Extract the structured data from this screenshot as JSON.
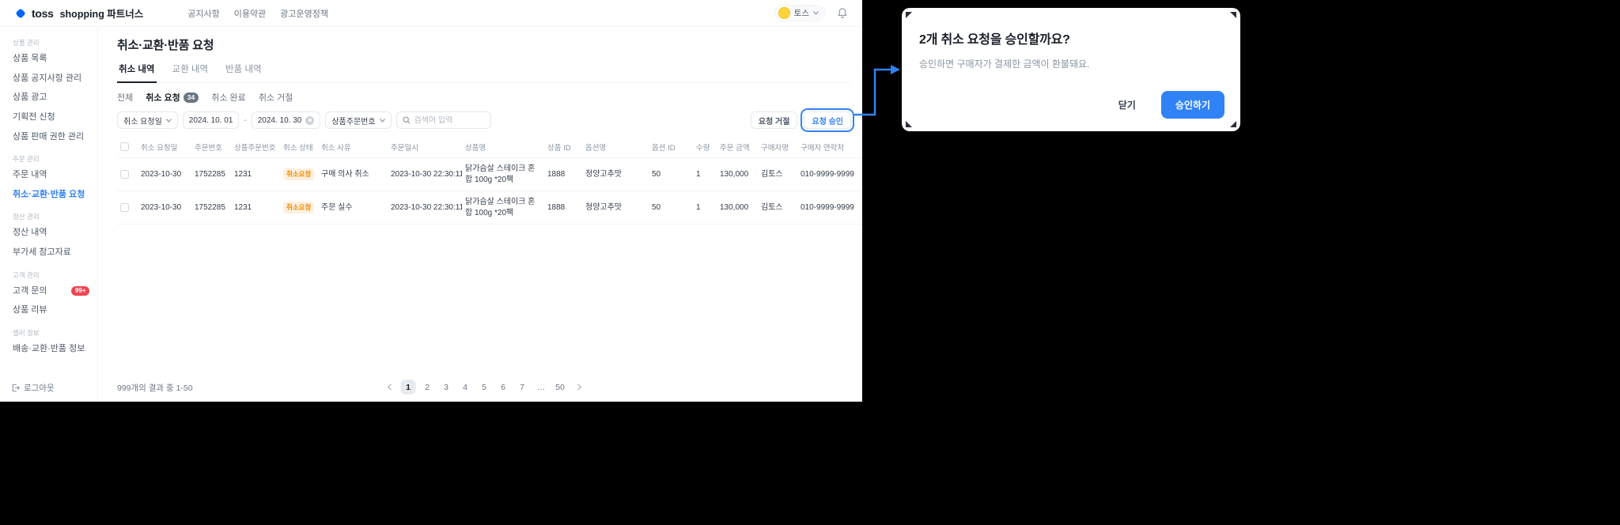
{
  "colors": {
    "accent": "#3182f6",
    "logo_blue": "#0064ff",
    "danger": "#f04452",
    "warning": "#f08c00"
  },
  "navbar": {
    "logo": "toss",
    "brand": "shopping 파트너스",
    "menu": [
      "공지사항",
      "이용약관",
      "광고운영정책"
    ],
    "user": "토스"
  },
  "sidebar": {
    "sections": [
      {
        "label": "상품 관리",
        "items": [
          "상품 목록",
          "상품 공지사항 관리",
          "상품 광고",
          "기획전 신청",
          "상품 판매 권한 관리"
        ]
      },
      {
        "label": "주문 관리",
        "items": [
          "주문 내역",
          "취소·교환·반품 요청"
        ]
      },
      {
        "label": "정산 관리",
        "items": [
          "정산 내역",
          "부가세 참고자료"
        ]
      },
      {
        "label": "고객 관리",
        "items": [
          "고객 문의",
          "상품 리뷰"
        ]
      },
      {
        "label": "셀러 정보",
        "items": [
          "배송·교환·반품 정보"
        ]
      }
    ],
    "inquiry_badge": "99+",
    "logout": "로그아웃"
  },
  "page": {
    "title": "취소·교환·반품 요청",
    "tabs": [
      "취소 내역",
      "교환 내역",
      "반품 내역"
    ],
    "chips": [
      "전체",
      "취소 요청",
      "취소 완료",
      "취소 거절"
    ],
    "chip_count": "34",
    "filters": {
      "date_type": "취소 요청일",
      "date_from": "2024. 10. 01",
      "date_to": "2024. 10. 30",
      "range_separator": "-",
      "search_type": "상품주문번호",
      "search_placeholder": "검색어 입력"
    },
    "actions": {
      "reject": "요청 거절",
      "approve": "요청 승인"
    }
  },
  "table": {
    "headers": [
      "취소 요청일",
      "주문번호",
      "상품주문번호",
      "취소 상태",
      "취소 사유",
      "주문일시",
      "상품명",
      "상품 ID",
      "옵션명",
      "옵션 ID",
      "수량",
      "주문 금액",
      "구매자명",
      "구매자 연락처"
    ],
    "rows": [
      {
        "request_date": "2023-10-30",
        "order_no": "1752285",
        "product_order_no": "1231",
        "status": "취소요청",
        "reason": "구매 의사 취소",
        "order_datetime": "2023-10-30 22:30:11",
        "product_name": "닭가슴살 스테이크 혼합 100g *20팩",
        "product_id": "1888",
        "option_name": "청양고추맛",
        "option_id": "50",
        "qty": "1",
        "amount": "130,000",
        "buyer_name": "김토스",
        "buyer_contact": "010-9999-9999"
      },
      {
        "request_date": "2023-10-30",
        "order_no": "1752285",
        "product_order_no": "1231",
        "status": "취소요청",
        "reason": "주문 실수",
        "order_datetime": "2023-10-30 22:30:11",
        "product_name": "닭가슴살 스테이크 혼합 100g *20팩",
        "product_id": "1888",
        "option_name": "청양고추맛",
        "option_id": "50",
        "qty": "1",
        "amount": "130,000",
        "buyer_name": "김토스",
        "buyer_contact": "010-9999-9999"
      }
    ]
  },
  "footer": {
    "summary": "999개의 결과 중 1-50",
    "pages": [
      "1",
      "2",
      "3",
      "4",
      "5",
      "6",
      "7",
      "…",
      "50"
    ]
  },
  "modal": {
    "title": "2개 취소 요청을 승인할까요?",
    "body": "승인하면 구매자가 결제한 금액이 환불돼요.",
    "close": "닫기",
    "approve": "승인하기"
  }
}
